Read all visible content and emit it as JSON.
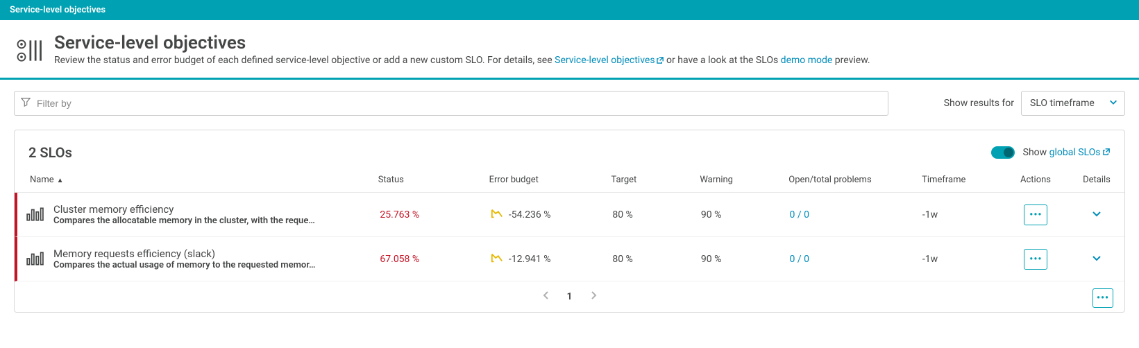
{
  "breadcrumb": {
    "label": "Service-level objectives"
  },
  "header": {
    "title": "Service-level objectives",
    "desc_pre": "Review the status and error budget of each defined service-level objective or add a new custom SLO. For details, see ",
    "link1": "Service-level objectives",
    "desc_mid": " or have a look at the SLOs ",
    "link2": "demo mode",
    "desc_post": " preview."
  },
  "filter": {
    "placeholder": "Filter by",
    "results_label": "Show results for",
    "select_value": "SLO timeframe"
  },
  "panel": {
    "count_label": "2 SLOs",
    "global_pre": "Show ",
    "global_link": "global SLOs"
  },
  "columns": {
    "name": "Name",
    "status": "Status",
    "budget": "Error budget",
    "target": "Target",
    "warning": "Warning",
    "problems": "Open/total problems",
    "timeframe": "Timeframe",
    "actions": "Actions",
    "details": "Details"
  },
  "rows": [
    {
      "name": "Cluster memory efficiency",
      "desc": "Compares the allocatable memory in the cluster, with the reque…",
      "status": "25.763 %",
      "budget": "-54.236 %",
      "target": "80 %",
      "warning": "90 %",
      "problems": "0 / 0",
      "timeframe": "-1w"
    },
    {
      "name": "Memory requests efficiency (slack)",
      "desc": "Compares the actual usage of memory to the requested memor…",
      "status": "67.058 %",
      "budget": "-12.941 %",
      "target": "80 %",
      "warning": "90 %",
      "problems": "0 / 0",
      "timeframe": "-1w"
    }
  ],
  "pager": {
    "current": "1"
  }
}
